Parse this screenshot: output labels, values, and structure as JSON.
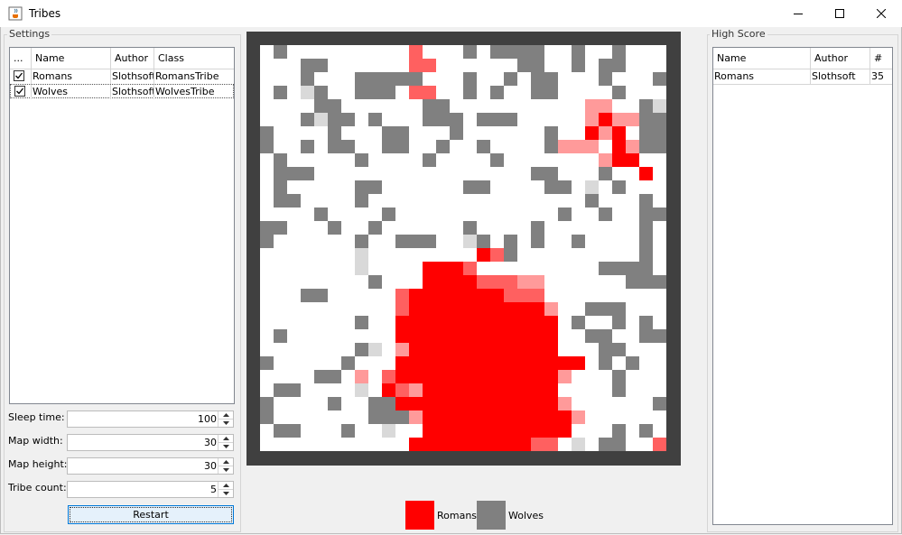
{
  "window": {
    "title": "Tribes",
    "icon": "java-cup-icon"
  },
  "settings": {
    "legend": "Settings",
    "table": {
      "columns": [
        "...",
        "Name",
        "Author",
        "Class"
      ],
      "rows": [
        {
          "checked": true,
          "name": "Romans",
          "author": "Slothsoft",
          "class": "RomansTribe"
        },
        {
          "checked": true,
          "name": "Wolves",
          "author": "Slothsoft",
          "class": "WolvesTribe"
        }
      ]
    },
    "fields": [
      {
        "label": "Sleep time:",
        "value": "100"
      },
      {
        "label": "Map width:",
        "value": "30"
      },
      {
        "label": "Map height:",
        "value": "30"
      },
      {
        "label": "Tribe count:",
        "value": "5"
      }
    ],
    "restart_label": "Restart"
  },
  "high_score": {
    "legend": "High Score",
    "columns": [
      "Name",
      "Author",
      "#"
    ],
    "rows": [
      {
        "name": "Romans",
        "author": "Slothsoft",
        "score": "35"
      }
    ]
  },
  "map": {
    "width": 30,
    "height": 30,
    "palette": {
      "W": "#ffffff",
      "G": "#808080",
      "L": "#d9d9d9",
      "R": "#ff0000",
      "r": "#ff6060",
      "p": "#ff9a9a"
    },
    "rows": [
      "WGWWWWWWWWWrWWWGWGGGGWWGWWGWWW",
      "WWWGGWWWWWWrrWWWWWWGGWWGWGGWWW",
      "WWWGWWWGGGGGWWWGWWGWGGWWWGWWWG",
      "WGWLGWWGGGWrrWWGWGWWGGWWWWGWWW",
      "WWWWGGWWWWWWGGWWWWWWWWWWppWWGL",
      "WWWGLGGWGWWWGGGWGGGWWWWWpRppGG",
      "GWWWWGWWWGGWWWGWWWWWWGWWRpRWGG",
      "GWWGWGGWWGGWWGWWGWWWWGpppWRpGG",
      "WGWWWWWGWWWWGWWWWGWWWWWWWpRRWW",
      "WGGGWWWWWWWWWWWWWWWWGGWWWGWWRW",
      "WGWWWWWGGWWWWWWGGWWWWGGWLWGWWW",
      "WGGWWWWGWWWWWWWWWWWWWWWWGWWWGW",
      "WWWWGWWWWGWWWWWWWWWWWWGWWGWWGG",
      "GGWWWGWWGWWWWWWGWWWWGWWWWWWWGW",
      "GWWWWWWGWWGGGWWLGWGWGWWGWWWWGW",
      "WWWWWWWLWWWWWWWWRrGWWWWWWWWWGW",
      "WWWWWWWLWWWWRRRrWWWWWWWWWGGGGW",
      "WWWWWWWWGWWWRRRRrrrppWWWWWWGGG",
      "WWWGGWWWWWrRRRRRRRrrrWWWWWWWWW",
      "WWWWWWWWWWrRRRRRRRRRRpWWGGGWWW",
      "WWWWWWWGWWRRRRRRRRRRRRWGWWGWGW",
      "WGWWWWWWWWRRRRRRRRRRRRWWGGWWGG",
      "WWWWWWWGLWpRRRRRRRRRRRWWWGGWWW",
      "GWWWWWGWWWRRRRRRRRRRRRRRWGWGWW",
      "WWWWGGWpWrRRRRRRRRRRRRpWWWGWWW",
      "WGGWWWWLWRrpRRRRRRRRRRWWWWGWWW",
      "GWWWWGWWGGRRRRRRRRRRRRpWWWWWWG",
      "GWWWWWWWGGGpRRRRRRRRRRRpWWWWWW",
      "WGGWWWGWWLWWRRRRRRRRRRRWWWGWGW",
      "WWWWWWWWWWWRRRRRRRRRrrWLWGGWWr"
    ]
  },
  "tribes_legend": [
    {
      "name": "Romans",
      "color": "#ff0000"
    },
    {
      "name": "Wolves",
      "color": "#808080"
    }
  ]
}
